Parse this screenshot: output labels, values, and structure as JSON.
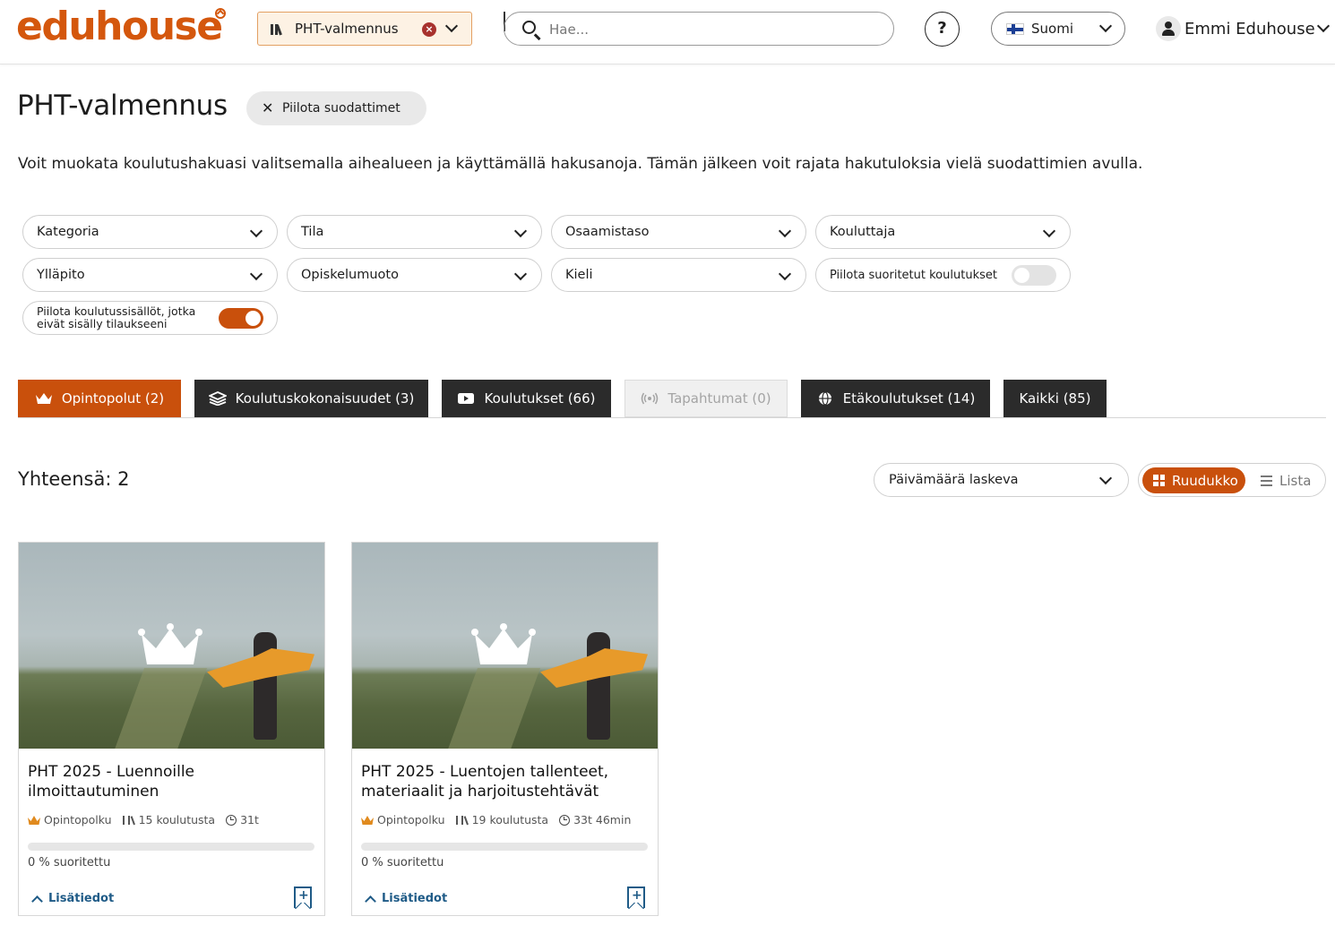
{
  "header": {
    "logo": "eduhouse",
    "context": "PHT-valmennus",
    "search_placeholder": "Hae...",
    "help": "?",
    "language": "Suomi",
    "user": "Emmi Eduhouse"
  },
  "page": {
    "title": "PHT-valmennus",
    "hide_filters": "Piilota suodattimet",
    "intro": "Voit muokata koulutushakuasi valitsemalla aihealueen ja käyttämällä hakusanoja. Tämän jälkeen voit rajata hakutuloksia vielä suodattimien avulla."
  },
  "filters": {
    "kategoria": "Kategoria",
    "tila": "Tila",
    "osaamistaso": "Osaamistaso",
    "kouluttaja": "Kouluttaja",
    "yllapito": "Ylläpito",
    "opiskelumuoto": "Opiskelumuoto",
    "kieli": "Kieli",
    "hide_completed": "Piilota suoritetut koulutukset",
    "hide_completed_on": false,
    "hide_outside_line1": "Piilota koulutussisällöt, jotka",
    "hide_outside_line2": "eivät sisälly tilaukseeni",
    "hide_outside_on": true
  },
  "tabs": [
    {
      "label": "Opintopolut (2)",
      "icon": "crown-icon",
      "active": true
    },
    {
      "label": "Koulutuskokonaisuudet (3)",
      "icon": "layers-icon"
    },
    {
      "label": "Koulutukset (66)",
      "icon": "play-icon"
    },
    {
      "label": "Tapahtumat (0)",
      "icon": "broadcast-icon",
      "disabled": true
    },
    {
      "label": "Etäkoulutukset (14)",
      "icon": "globe-icon"
    },
    {
      "label": "Kaikki (85)"
    }
  ],
  "results": {
    "total": "Yhteensä: 2",
    "sort": "Päivämäärä laskeva",
    "view_grid": "Ruudukko",
    "view_list": "Lista"
  },
  "cards": [
    {
      "title_line1": "PHT 2025 - Luennoille",
      "title_line2": "ilmoittautuminen",
      "type": "Opintopolku",
      "count": "15 koulutusta",
      "duration": "31t",
      "progress": 0,
      "done": "0 % suoritettu",
      "more": "Lisätiedot"
    },
    {
      "title_line1": "PHT 2025 - Luentojen tallenteet,",
      "title_line2": "materiaalit ja harjoitustehtävät",
      "type": "Opintopolku",
      "count": "19 koulutusta",
      "duration": "33t 46min",
      "progress": 0,
      "done": "0 % suoritettu",
      "more": "Lisätiedot"
    }
  ],
  "colors": {
    "brand": "#d4570d",
    "accent": "#c9500c",
    "dark": "#2b2b2b",
    "link": "#1f5b87"
  }
}
